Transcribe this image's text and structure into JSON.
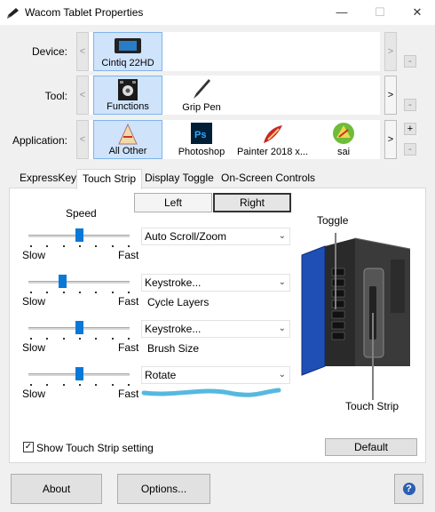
{
  "window": {
    "title": "Wacom Tablet Properties",
    "minimize": "—",
    "maximize": "☐",
    "close": "✕"
  },
  "device_row": {
    "label": "Device:",
    "items": [
      {
        "label": "Cintiq 22HD",
        "selected": true
      }
    ]
  },
  "tool_row": {
    "label": "Tool:",
    "items": [
      {
        "label": "Functions",
        "selected": true
      },
      {
        "label": "Grip Pen",
        "selected": false
      }
    ]
  },
  "application_row": {
    "label": "Application:",
    "items": [
      {
        "label": "All Other",
        "selected": true
      },
      {
        "label": "Photoshop",
        "selected": false
      },
      {
        "label": "Painter 2018 x...",
        "selected": false
      },
      {
        "label": "sai",
        "selected": false
      }
    ]
  },
  "nav": {
    "prev": "<",
    "next": ">",
    "add": "+",
    "remove": "-"
  },
  "tabs": [
    {
      "label": "ExpressKeys",
      "active": false
    },
    {
      "label": "Touch Strip",
      "active": true
    },
    {
      "label": "Display Toggle",
      "active": false
    },
    {
      "label": "On-Screen Controls",
      "active": false
    }
  ],
  "side_toggle": {
    "left": "Left",
    "right": "Right",
    "selected": "Right"
  },
  "speed": {
    "title": "Speed",
    "slow": "Slow",
    "fast": "Fast"
  },
  "strip_rows": [
    {
      "level": 0.5,
      "action": "Auto Scroll/Zoom",
      "sub": ""
    },
    {
      "level": 0.33,
      "action": "Keystroke...",
      "sub": "Cycle Layers"
    },
    {
      "level": 0.5,
      "action": "Keystroke...",
      "sub": "Brush Size"
    },
    {
      "level": 0.5,
      "action": "Rotate",
      "sub": ""
    }
  ],
  "diagram": {
    "toggle_label": "Toggle",
    "touch_strip_label": "Touch Strip"
  },
  "show_setting": {
    "label": "Show Touch Strip setting",
    "checked": true,
    "check_glyph": "✓"
  },
  "buttons": {
    "default": "Default",
    "about": "About",
    "options": "Options...",
    "help": "?"
  },
  "colors": {
    "selection": "#cfe3fb",
    "accent": "#0a78d7",
    "annotation": "#56b8e0"
  }
}
